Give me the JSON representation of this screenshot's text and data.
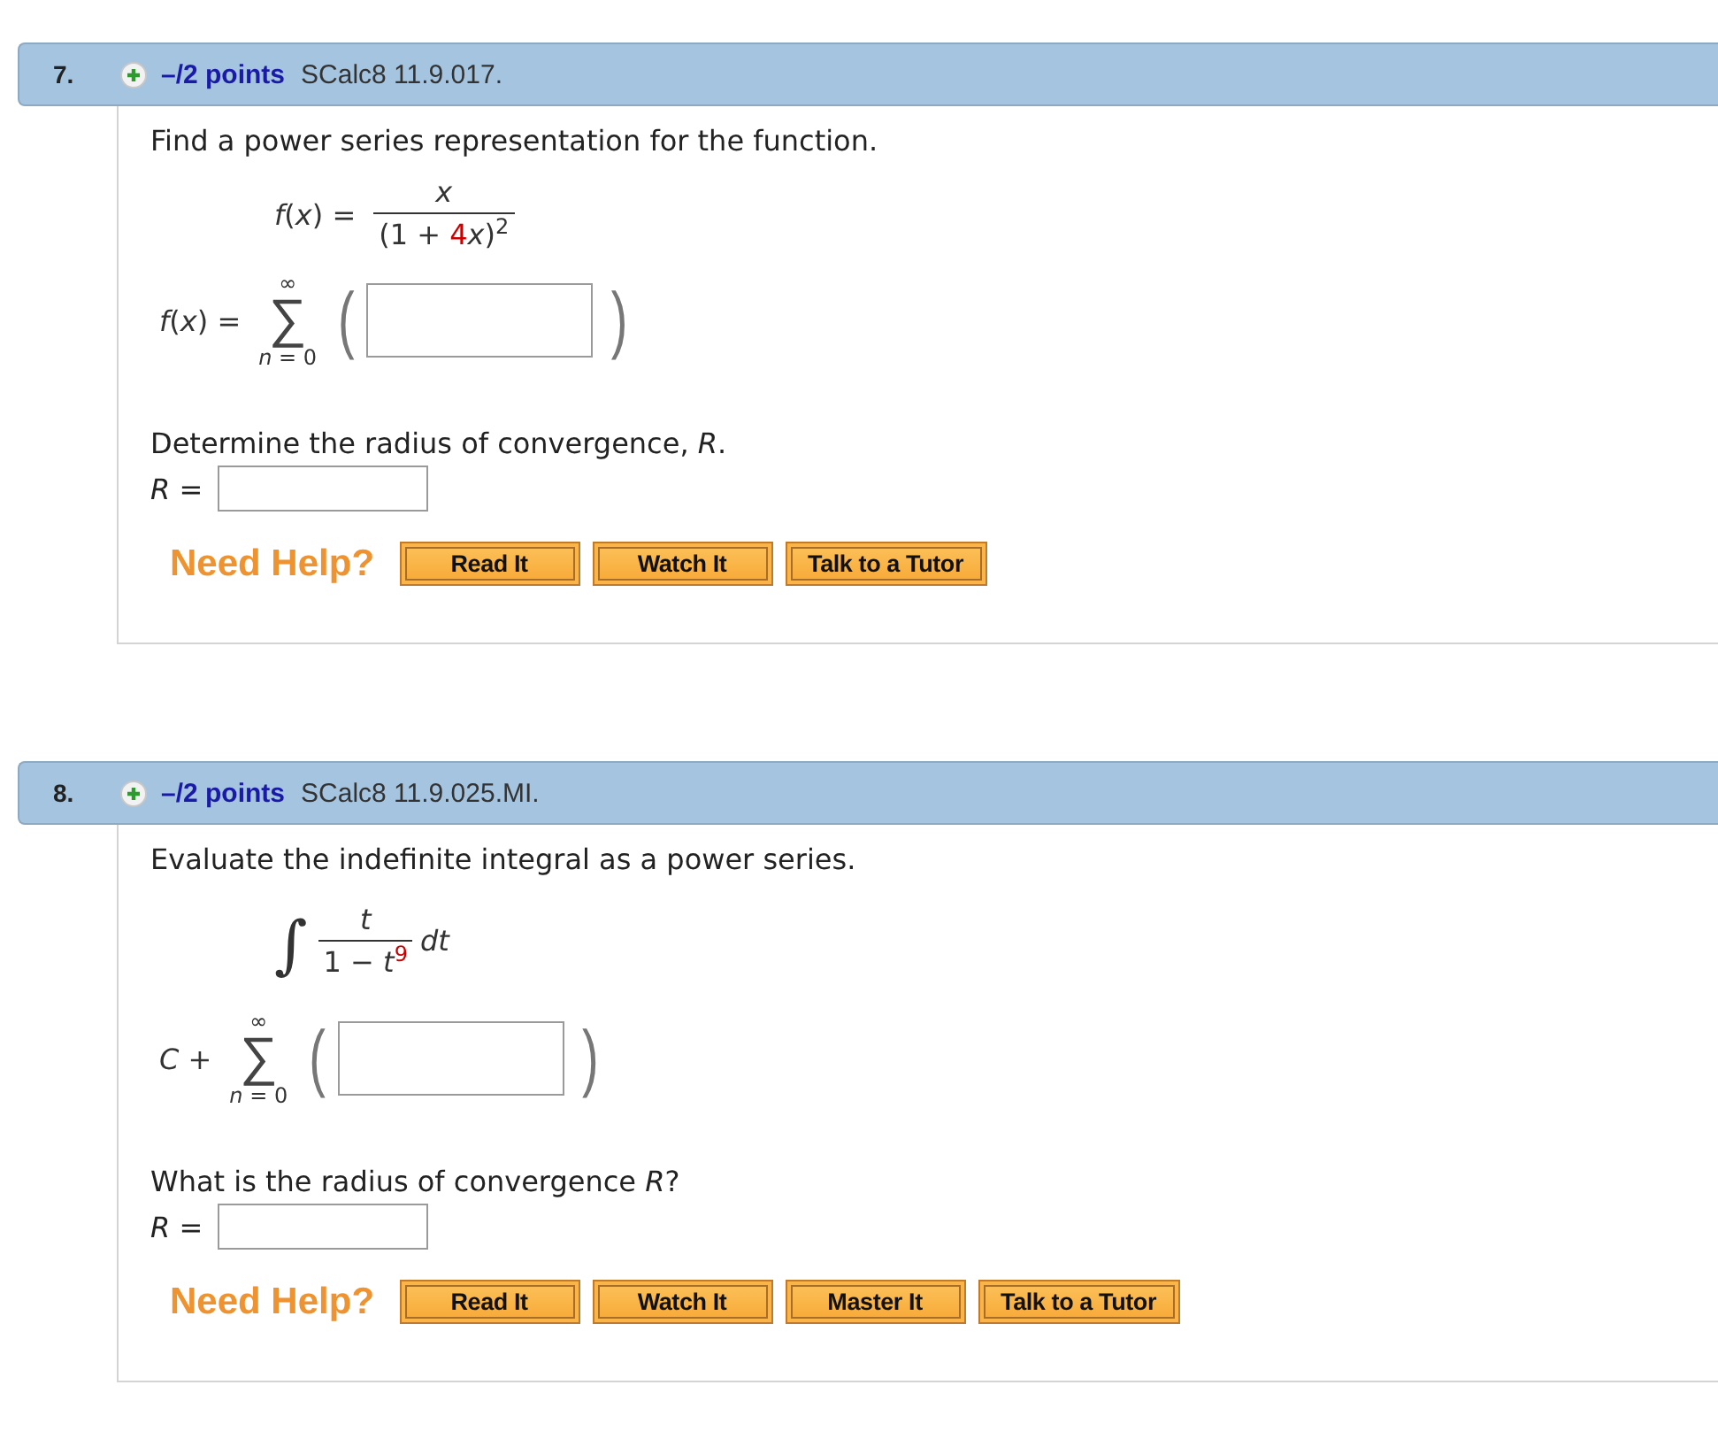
{
  "questions": [
    {
      "number": "7.",
      "points": "–/2 points",
      "source": "SCalc8 11.9.017.",
      "prompt": "Find a power series representation for the function.",
      "given": {
        "kind": "function",
        "lhs": "*f*(*x*) =",
        "numerator": "x",
        "denominator": [
          {
            "text": "(1 + "
          },
          {
            "text": "4",
            "color": "#cc0000"
          },
          {
            "text": "*x*)$^{2}$"
          }
        ]
      },
      "series": {
        "lhs": "*f*(*x*) =",
        "symbol": "∑",
        "upper": "∞",
        "lower": "*n* = 0",
        "open": "(",
        "close": ")"
      },
      "radius": {
        "prompt": "Determine the radius of convergence, *R*.",
        "label": "*R* ="
      },
      "help": {
        "label": "Need Help?",
        "buttons": [
          "Read It",
          "Watch It",
          "Talk to a Tutor"
        ]
      }
    },
    {
      "number": "8.",
      "points": "–/2 points",
      "source": "SCalc8 11.9.025.MI.",
      "prompt": "Evaluate the indefinite integral as a power series.",
      "given": {
        "kind": "integral",
        "symbol": "∫",
        "numerator": "t",
        "denominator": [
          {
            "text": "1 − *t*"
          },
          {
            "text": "$^{9}$",
            "color": "#cc0000"
          }
        ],
        "differential": "dt"
      },
      "series": {
        "lhs": "*C* +",
        "symbol": "∑",
        "upper": "∞",
        "lower": "*n* = 0",
        "open": "(",
        "close": ")"
      },
      "radius": {
        "prompt": "What is the radius of convergence *R*?",
        "label": "*R* ="
      },
      "help": {
        "label": "Need Help?",
        "buttons": [
          "Read It",
          "Watch It",
          "Master It",
          "Talk to a Tutor"
        ]
      }
    }
  ]
}
